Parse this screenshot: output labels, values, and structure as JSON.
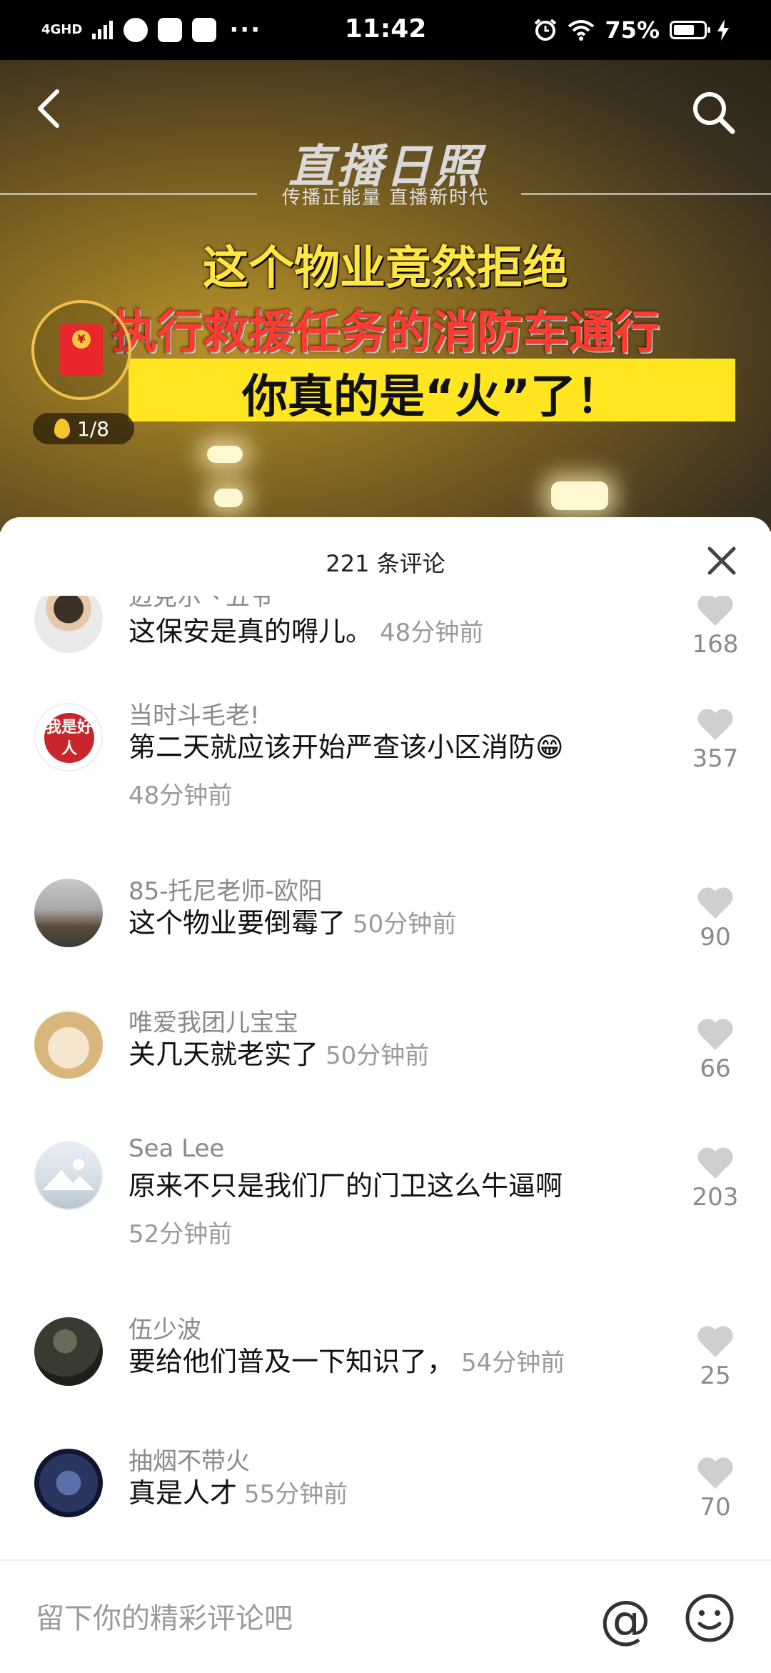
{
  "status_bar": {
    "network": "4GHD",
    "time": "11:42",
    "battery": "75%",
    "icons": [
      "signal-icon",
      "chat-icon",
      "send-icon",
      "app-icon",
      "alarm-icon",
      "wifi-icon",
      "battery-icon",
      "charging-icon"
    ]
  },
  "video": {
    "brand": "直播日照",
    "slogan": "传播正能量 直播新时代",
    "caption_line1": "这个物业竟然拒绝",
    "caption_line2": "执行救援任务的消防车通行",
    "caption_line3": "你真的是“火”了！",
    "red_packet_symbol": "¥",
    "pager": "1/8"
  },
  "comments_panel": {
    "title": "221 条评论",
    "comments": [
      {
        "user": "迈克尔丶五爷",
        "text": "这保安是真的嘚儿。",
        "time": "48分钟前",
        "likes": "168"
      },
      {
        "user": "当时斗毛老!",
        "text": "第二天就应该开始严查该小区消防😁",
        "time": "48分钟前",
        "likes": "357"
      },
      {
        "user": "85-托尼老师-欧阳",
        "text": "这个物业要倒霉了",
        "time": "50分钟前",
        "likes": "90"
      },
      {
        "user": "唯爱我团儿宝宝",
        "text": "关几天就老实了",
        "time": "50分钟前",
        "likes": "66"
      },
      {
        "user": "Sea Lee",
        "text": "原来不只是我们厂的门卫这么牛逼啊",
        "time": "52分钟前",
        "likes": "203"
      },
      {
        "user": "伍少波",
        "text": "要给他们普及一下知识了，",
        "time": "54分钟前",
        "likes": "25"
      },
      {
        "user": "抽烟不带火",
        "text": "真是人才",
        "time": "55分钟前",
        "likes": "70"
      }
    ]
  },
  "input": {
    "placeholder": "留下你的精彩评论吧",
    "at_symbol": "@"
  },
  "avatar2_text": "我是好人"
}
